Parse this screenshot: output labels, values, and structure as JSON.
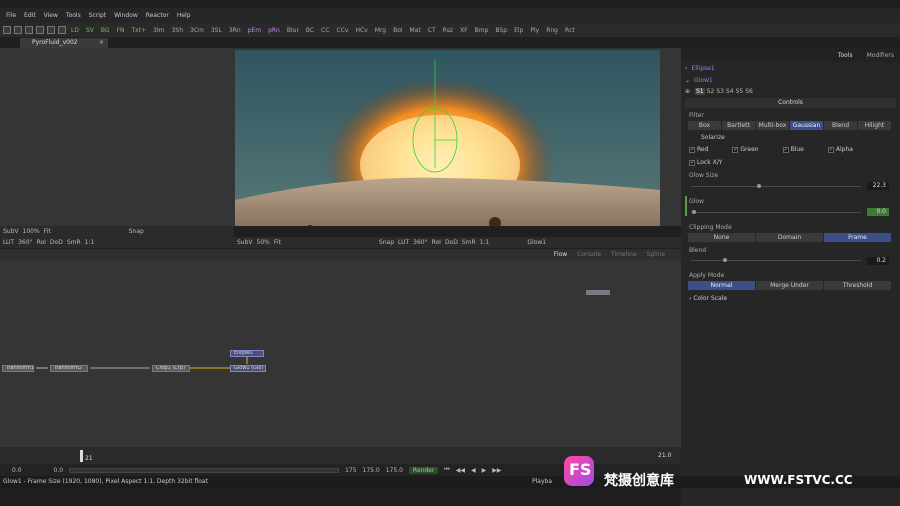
{
  "menu": [
    "File",
    "Edit",
    "View",
    "Tools",
    "Script",
    "Window",
    "Reactor",
    "Help"
  ],
  "toolbar": [
    {
      "label": "LD",
      "c": "green"
    },
    {
      "label": "SV",
      "c": "green"
    },
    {
      "label": "BG",
      "c": "green"
    },
    {
      "label": "FN",
      "c": "green"
    },
    {
      "label": "Txt+",
      "c": "green"
    },
    {
      "label": "3Im",
      "c": "gray"
    },
    {
      "label": "3Sh",
      "c": "gray"
    },
    {
      "label": "3Cm",
      "c": "gray"
    },
    {
      "label": "3SL",
      "c": "gray"
    },
    {
      "label": "3Rn",
      "c": "gray"
    },
    {
      "label": "pEm",
      "c": "purple"
    },
    {
      "label": "pRn",
      "c": "purple"
    },
    {
      "label": "Blur",
      "c": "gray"
    },
    {
      "label": "BC",
      "c": "gray"
    },
    {
      "label": "CC",
      "c": "gray"
    },
    {
      "label": "CCv",
      "c": "gray"
    },
    {
      "label": "HCv",
      "c": "gray"
    },
    {
      "label": "Mrg",
      "c": "gray"
    },
    {
      "label": "Bol",
      "c": "gray"
    },
    {
      "label": "Mat",
      "c": "gray"
    },
    {
      "label": "CT",
      "c": "gray"
    },
    {
      "label": "Rsz",
      "c": "gray"
    },
    {
      "label": "XF",
      "c": "gray"
    },
    {
      "label": "Bmp",
      "c": "gray"
    },
    {
      "label": "BSp",
      "c": "gray"
    },
    {
      "label": "Elp",
      "c": "gray"
    },
    {
      "label": "Ply",
      "c": "gray"
    },
    {
      "label": "Rng",
      "c": "gray"
    },
    {
      "label": "Rct",
      "c": "gray"
    }
  ],
  "doc_tab": "PyroFluid_v002",
  "doc_tab_close": "×",
  "viewer_left": {
    "row1": [
      "SubV",
      "100%",
      "Fit",
      "Snap"
    ],
    "row2": [
      "LUT",
      "360°",
      "RoI",
      "DoD",
      "SmR",
      "1:1"
    ]
  },
  "viewer_right": {
    "row1": [
      "SubV",
      "50%",
      "Fit",
      "Snap"
    ],
    "row2": [
      "LUT",
      "360°",
      "RoI",
      "DoD",
      "SmR",
      "1:1"
    ],
    "node_label": "Glow1"
  },
  "right_panel": {
    "tabs": [
      "Tools",
      "Modifiers"
    ],
    "nodes": [
      "Ellipse1",
      "Glow1"
    ],
    "views": [
      "S1",
      "S2",
      "S3",
      "S4",
      "S5",
      "S6"
    ],
    "controls_title": "Controls",
    "filter_label": "Filter",
    "filter_options": [
      "Box",
      "Bartlett",
      "Multi-box",
      "Gaussian",
      "Blend",
      "Hilight"
    ],
    "filter_selected": "Gaussian",
    "solarize": "Solarize",
    "channels": [
      "Red",
      "Green",
      "Blue",
      "Alpha"
    ],
    "lock_xy": "Lock X/Y",
    "glow_size_label": "Glow Size",
    "glow_size_value": "22.3",
    "glow_size_fraction": 0.4,
    "glow_label": "Glow",
    "glow_value": "0.0",
    "glow_fraction": 0.02,
    "clipping_label": "Clipping Mode",
    "clipping_options": [
      "None",
      "Domain",
      "Frame"
    ],
    "clipping_selected": "Frame",
    "blend_label": "Blend",
    "blend_value": "0.2",
    "blend_fraction": 0.2,
    "apply_label": "Apply Mode",
    "apply_options": [
      "Normal",
      "Merge Under",
      "Threshold"
    ],
    "apply_selected": "Normal",
    "color_scale": "Color Scale"
  },
  "flow": {
    "tabs": [
      "Flow",
      "Console",
      "Timeline",
      "Spline"
    ],
    "nodes": [
      "Transform1",
      "Transform2",
      "Crop1 (Crp)",
      "Glow1 (Glo)",
      "Ellipse1"
    ]
  },
  "timeline": {
    "frame_marker": "21",
    "end": "21.0"
  },
  "transport": {
    "start": "0.0",
    "pos": "0.0",
    "range_start": "",
    "range_end": "175",
    "global_end_a": "175.0",
    "global_end_b": "175.0",
    "render": "Render",
    "playback": "Playba"
  },
  "statusbar": "Glow1 - Frame Size (1920, 1080), Pixel Aspect 1:1, Depth 32bit float",
  "watermark": {
    "logo": "FS",
    "brand": "梵摄创意库",
    "url": "WWW.FSTVC.CC"
  }
}
